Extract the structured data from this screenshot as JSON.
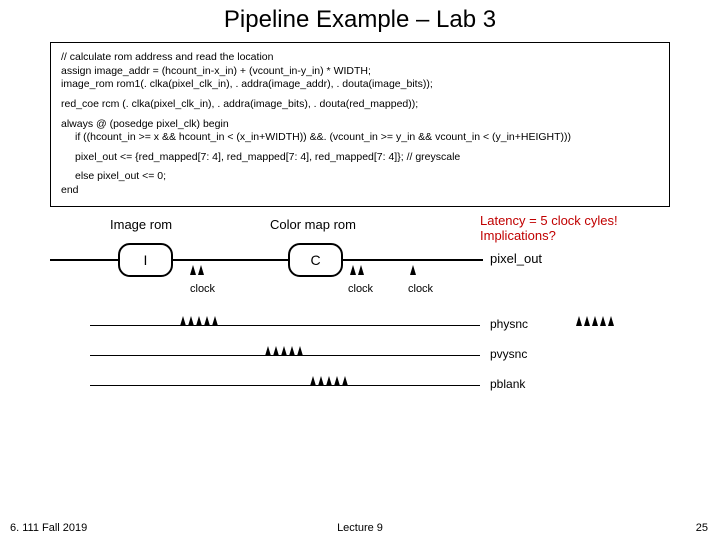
{
  "title": "Pipeline Example – Lab 3",
  "code": {
    "line1": "// calculate rom address and read the location",
    "line2": "assign image_addr = (hcount_in-x_in) + (vcount_in-y_in) * WIDTH;",
    "line3": "image_rom  rom1(. clka(pixel_clk_in), . addra(image_addr), . douta(image_bits));",
    "line4": "red_coe rcm (. clka(pixel_clk_in), . addra(image_bits), . douta(red_mapped));",
    "line5": "always @ (posedge pixel_clk) begin",
    "line6": "if ((hcount_in >= x && hcount_in < (x_in+WIDTH)) &&. (vcount_in >= y_in && vcount_in < (y_in+HEIGHT)))",
    "line7": "pixel_out <= {red_mapped[7: 4], red_mapped[7: 4], red_mapped[7: 4]}; // greyscale",
    "line8": "else pixel_out <= 0;",
    "line9": "end"
  },
  "labels": {
    "image_rom": "Image rom",
    "color_rom": "Color  map rom",
    "latency1": "Latency = 5 clock cyles!",
    "latency2": "Implications?",
    "pixel_out": "pixel_out",
    "clock": "clock",
    "rom_i": "I",
    "rom_c": "C",
    "physnc": "physnc",
    "pvysnc": "pvysnc",
    "pblank": "pblank"
  },
  "footer": {
    "left": "6. 111 Fall 2019",
    "center": "Lecture 9",
    "right": "25"
  }
}
